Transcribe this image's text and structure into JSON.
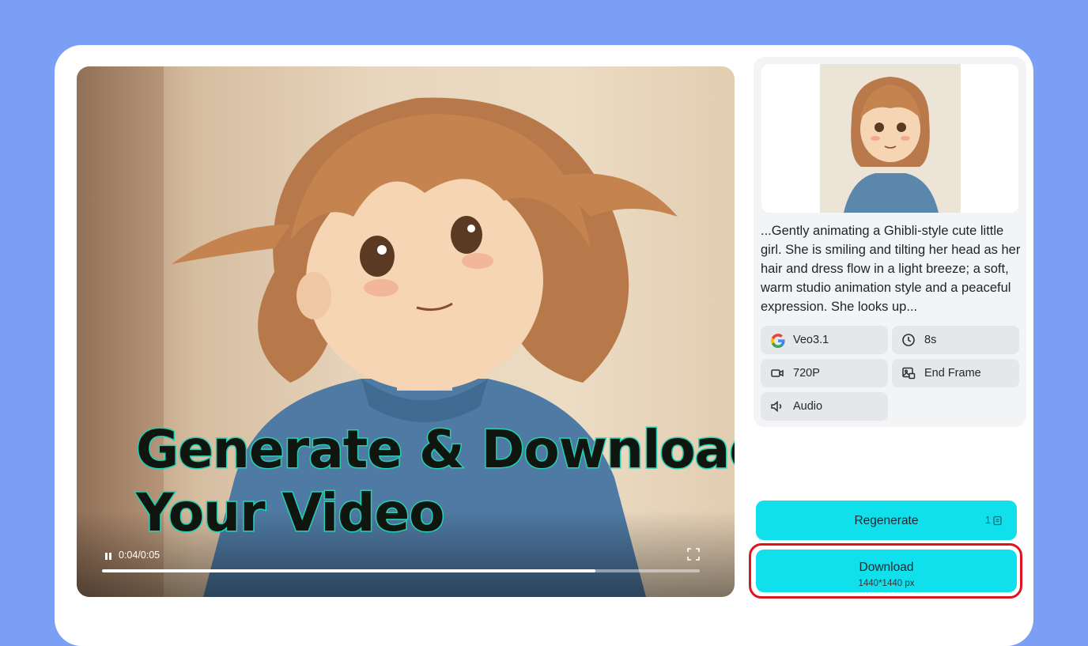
{
  "video": {
    "headline_line1": "Generate & Download",
    "headline_line2": "Your Video",
    "timecode": "0:04/0:05",
    "progress": 0.825
  },
  "panel": {
    "prompt": "...Gently animating a Ghibli-style cute little girl. She is smiling and tilting her head as her hair and dress flow in a light breeze; a soft, warm studio animation style and a peaceful expression. She looks up...",
    "chips": {
      "model": "Veo3.1",
      "duration": "8s",
      "resolution": "720P",
      "end_frame": "End Frame",
      "audio": "Audio"
    }
  },
  "actions": {
    "regenerate": "Regenerate",
    "regenerate_cost": "1",
    "download": "Download",
    "download_size": "1440*1440 px"
  },
  "colors": {
    "background": "#7b9ff5",
    "button": "#10e0ec",
    "highlight": "#e0141e",
    "headline_outline": "#27d3b5"
  },
  "icons": [
    "pause-icon",
    "fullscreen-icon",
    "google-icon",
    "clock-icon",
    "video-camera-icon",
    "end-frame-icon",
    "audio-icon",
    "credit-icon"
  ]
}
